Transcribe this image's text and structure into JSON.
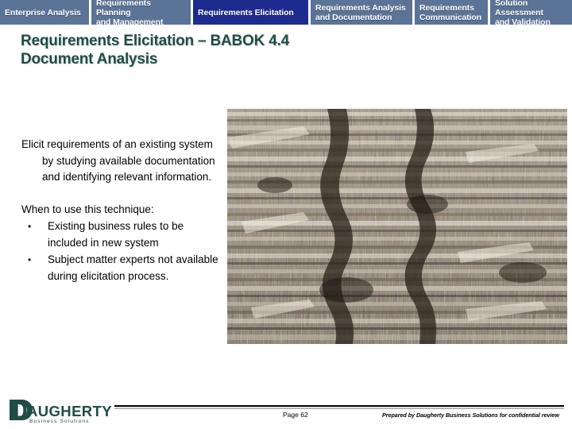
{
  "navigation": {
    "tabs": [
      {
        "label": "Enterprise Analysis",
        "active": false,
        "width": 112
      },
      {
        "label": "Requirements Planning\nand Management",
        "active": false,
        "width": 125
      },
      {
        "label": "Requirements Elicitation",
        "active": true,
        "width": 145
      },
      {
        "label": "Requirements Analysis\nand Documentation",
        "active": false,
        "width": 128
      },
      {
        "label": "Requirements\nCommunication",
        "active": false,
        "width": 92
      },
      {
        "label": "Solution Assessment\nand Validation",
        "active": false,
        "width": 112
      }
    ]
  },
  "slide": {
    "title": "Requirements Elicitation – BABOK 4.4\nDocument Analysis",
    "title_color": "#1f4d46",
    "definition": {
      "line1": "Elicit requirements of an existing",
      "rest": "system by studying available documentation and identifying relevant information."
    },
    "when_heading": "When to use this technique:",
    "bullets": [
      "Existing business rules to be included in new system",
      "Subject matter experts not available during elicitation process."
    ],
    "bullet_glyph": "•"
  },
  "photo": {
    "alt": "Large stacks of bundled newspapers and paper documents",
    "name": "stacked-documents-photo"
  },
  "footer": {
    "page_label": "Page 62",
    "confidential_notice": "Prepared by Daugherty Business Solutions for confidential review"
  },
  "logo": {
    "dropcap": "D",
    "wordmark": "AUGHERTY",
    "tagline": "Business Solutions",
    "color": "#1f4d46"
  },
  "colors": {
    "tab_inactive": "#5b7396",
    "tab_active": "#1d2a8e",
    "tab_text": "#ffffff",
    "brand_teal": "#1f4d46",
    "body_text": "#000000"
  }
}
